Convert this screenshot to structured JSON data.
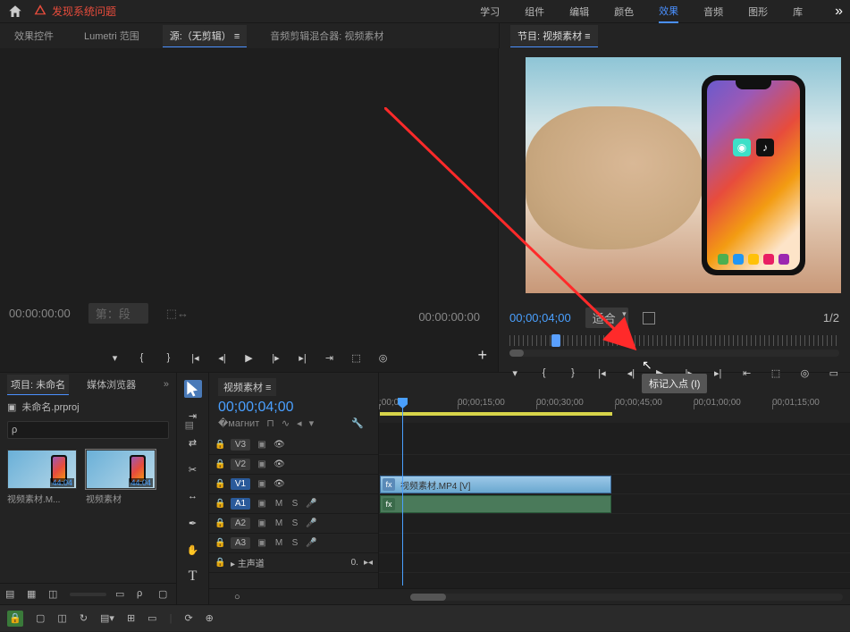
{
  "topbar": {
    "system_issue": "发现系统问题",
    "workspaces": [
      "学习",
      "组件",
      "编辑",
      "颜色",
      "效果",
      "音频",
      "图形",
      "库"
    ],
    "active_workspace": 4
  },
  "source_panel": {
    "tabs": [
      "效果控件",
      "Lumetri 范围",
      "源:（无剪辑）",
      "音频剪辑混合器: 视频素材"
    ],
    "active_tab": 2,
    "tc_left": "00:00:00:00",
    "dropdown": "第：段",
    "tc_right": "00:00:00:00"
  },
  "program_panel": {
    "title": "节目: 视频素材",
    "tc": "00;00;04;00",
    "fit_label": "适合",
    "fraction": "1/2",
    "tooltip": "标记入点 (I)"
  },
  "project": {
    "tabs": [
      "项目: 未命名",
      "媒体浏览器"
    ],
    "active_tab": 0,
    "file": "未命名.prproj",
    "search_placeholder": "ρ",
    "items": [
      {
        "name": "视频素材.M...",
        "dur": "44:04"
      },
      {
        "name": "视频素材",
        "dur": "44:04"
      }
    ]
  },
  "timeline": {
    "seq_name": "视频素材",
    "tc": "00;00;04;00",
    "ruler": [
      ";00;00",
      "00;00;15;00",
      "00;00;30;00",
      "00;00;45;00",
      "00;01;00;00",
      "00;01;15;00"
    ],
    "ruler_positions": [
      0,
      88,
      176,
      264,
      352,
      440
    ],
    "video_tracks": [
      "V3",
      "V2",
      "V1"
    ],
    "audio_tracks": [
      "A1",
      "A2",
      "A3"
    ],
    "master": "主声道",
    "clip_name": "视频素材.MP4 [V]",
    "audio_level": "0."
  }
}
